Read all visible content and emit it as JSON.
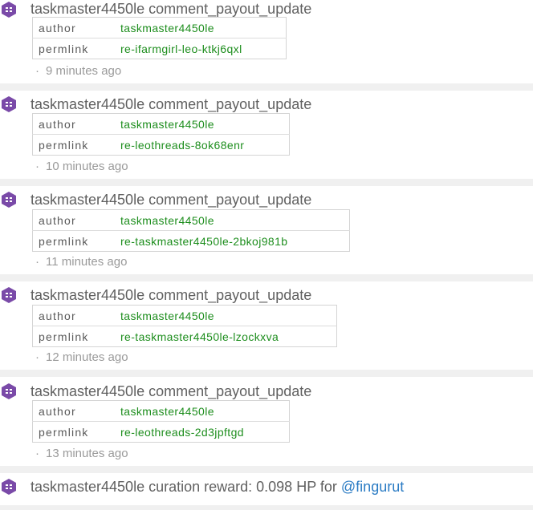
{
  "colors": {
    "icon_purple": "#7a4aa8",
    "value_green": "#1e8e1e",
    "link_blue": "#2a7bc4",
    "separator": "#e6e6e6"
  },
  "icon": "steem-operation-icon",
  "entries": [
    {
      "user": "taskmaster4450le",
      "op": "comment_payout_update",
      "author_key": "author",
      "author_val": "taskmaster4450le",
      "permlink_key": "permlink",
      "permlink_val": "re-ifarmgirl-leo-ktkj6qxl",
      "time_dot": "·",
      "time": "9 minutes ago"
    },
    {
      "user": "taskmaster4450le",
      "op": "comment_payout_update",
      "author_key": "author",
      "author_val": "taskmaster4450le",
      "permlink_key": "permlink",
      "permlink_val": "re-leothreads-8ok68enr",
      "time_dot": "·",
      "time": "10 minutes ago"
    },
    {
      "user": "taskmaster4450le",
      "op": "comment_payout_update",
      "author_key": "author",
      "author_val": "taskmaster4450le",
      "permlink_key": "permlink",
      "permlink_val": "re-taskmaster4450le-2bkoj981b",
      "time_dot": "·",
      "time": "11 minutes ago"
    },
    {
      "user": "taskmaster4450le",
      "op": "comment_payout_update",
      "author_key": "author",
      "author_val": "taskmaster4450le",
      "permlink_key": "permlink",
      "permlink_val": "re-taskmaster4450le-lzockxva",
      "time_dot": "·",
      "time": "12 minutes ago"
    },
    {
      "user": "taskmaster4450le",
      "op": "comment_payout_update",
      "author_key": "author",
      "author_val": "taskmaster4450le",
      "permlink_key": "permlink",
      "permlink_val": "re-leothreads-2d3jpftgd",
      "time_dot": "·",
      "time": "13 minutes ago"
    }
  ],
  "last": {
    "user": "taskmaster4450le",
    "text": "curation reward: 0.098 HP for",
    "link": "@fingurut"
  }
}
